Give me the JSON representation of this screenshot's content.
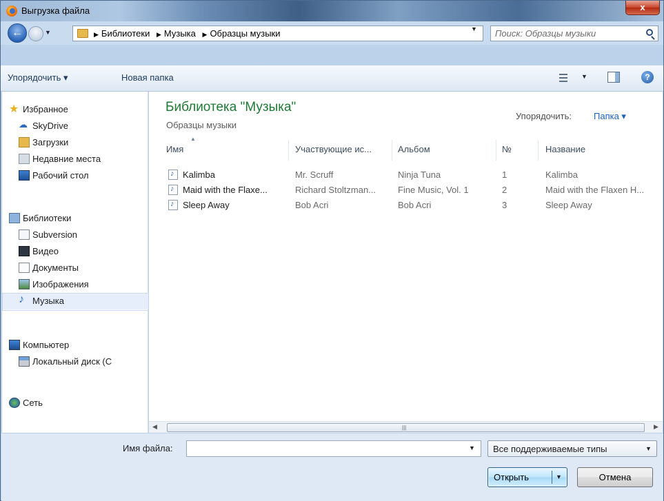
{
  "window": {
    "title": "Выгрузка файла",
    "close_label": "x"
  },
  "address": {
    "crumbs": [
      "Библиотеки",
      "Музыка",
      "Образцы музыки"
    ],
    "search_placeholder": "Поиск: Образцы музыки"
  },
  "toolbar": {
    "organize_label": "Упорядочить ▾",
    "new_folder_label": "Новая папка"
  },
  "nav": {
    "favorites": "Избранное",
    "skydrive": "SkyDrive",
    "downloads": "Загрузки",
    "recent": "Недавние места",
    "desktop": "Рабочий стол",
    "libraries": "Библиотеки",
    "subversion": "Subversion",
    "video": "Видео",
    "documents": "Документы",
    "images": "Изображения",
    "music": "Музыка",
    "computer": "Компьютер",
    "local_disk": "Локальный диск (C",
    "network": "Сеть"
  },
  "content": {
    "title": "Библиотека \"Музыка\"",
    "subtitle": "Образцы музыки",
    "arrange_label": "Упорядочить:",
    "arrange_value": "Папка ▾",
    "columns": [
      "Имя",
      "Участвующие ис...",
      "Альбом",
      "№",
      "Название"
    ],
    "rows": [
      {
        "name": "Kalimba",
        "artist": "Mr. Scruff",
        "album": "Ninja Tuna",
        "num": "1",
        "title": "Kalimba"
      },
      {
        "name": "Maid with the Flaxe...",
        "artist": "Richard Stoltzman...",
        "album": "Fine Music, Vol. 1",
        "num": "2",
        "title": "Maid with the Flaxen H..."
      },
      {
        "name": "Sleep Away",
        "artist": "Bob Acri",
        "album": "Bob Acri",
        "num": "3",
        "title": "Sleep Away"
      }
    ]
  },
  "footer": {
    "filename_label": "Имя файла:",
    "filename_value": "",
    "filetype": "Все поддерживаемые типы",
    "open_label": "Открыть",
    "cancel_label": "Отмена"
  },
  "colors": {
    "library_title": "#1e7b34",
    "link_blue": "#1a61c0",
    "selected_nav": "#e5eefa"
  }
}
